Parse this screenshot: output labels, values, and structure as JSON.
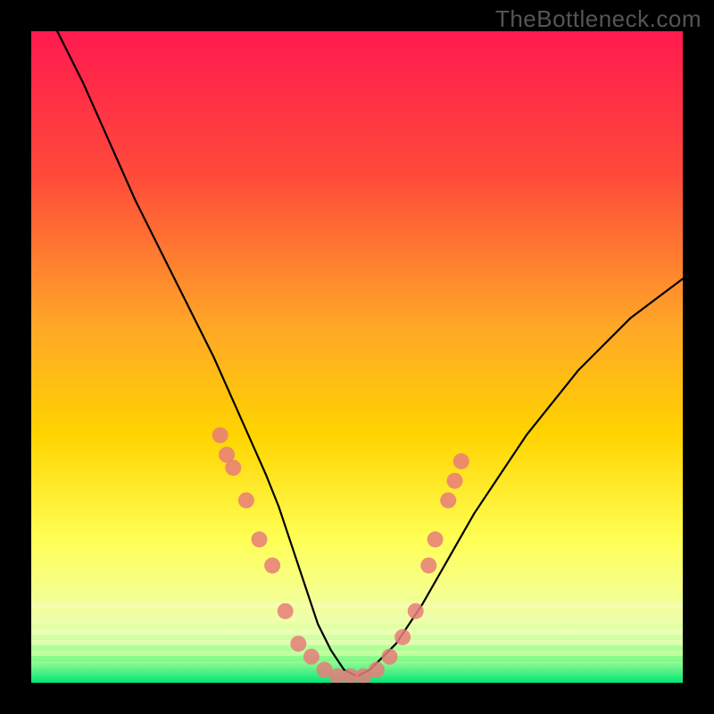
{
  "watermark": "TheBottleneck.com",
  "chart_data": {
    "type": "line",
    "title": "",
    "xlabel": "",
    "ylabel": "",
    "xlim": [
      0,
      100
    ],
    "ylim": [
      0,
      100
    ],
    "background_gradient": {
      "top": "#ff1a4f",
      "mid_upper": "#ff7a2a",
      "mid": "#ffd400",
      "mid_lower": "#ffff66",
      "band": "#f6ffb0",
      "bottom": "#00e676"
    },
    "curve": {
      "name": "bottleneck-curve",
      "x": [
        4,
        8,
        12,
        16,
        20,
        24,
        28,
        32,
        36,
        38,
        40,
        42,
        44,
        46,
        48,
        50,
        52,
        56,
        60,
        64,
        68,
        72,
        76,
        80,
        84,
        88,
        92,
        96,
        100
      ],
      "y": [
        100,
        92,
        83,
        74,
        66,
        58,
        50,
        41,
        32,
        27,
        21,
        15,
        9,
        5,
        2,
        1,
        2,
        6,
        12,
        19,
        26,
        32,
        38,
        43,
        48,
        52,
        56,
        59,
        62
      ]
    },
    "markers": {
      "name": "sample-points",
      "color": "#e77d7a",
      "points": [
        {
          "x": 29,
          "y": 38
        },
        {
          "x": 30,
          "y": 35
        },
        {
          "x": 31,
          "y": 33
        },
        {
          "x": 33,
          "y": 28
        },
        {
          "x": 35,
          "y": 22
        },
        {
          "x": 37,
          "y": 18
        },
        {
          "x": 39,
          "y": 11
        },
        {
          "x": 41,
          "y": 6
        },
        {
          "x": 43,
          "y": 4
        },
        {
          "x": 45,
          "y": 2
        },
        {
          "x": 47,
          "y": 1
        },
        {
          "x": 49,
          "y": 1
        },
        {
          "x": 51,
          "y": 1
        },
        {
          "x": 53,
          "y": 2
        },
        {
          "x": 55,
          "y": 4
        },
        {
          "x": 57,
          "y": 7
        },
        {
          "x": 59,
          "y": 11
        },
        {
          "x": 61,
          "y": 18
        },
        {
          "x": 62,
          "y": 22
        },
        {
          "x": 64,
          "y": 28
        },
        {
          "x": 65,
          "y": 31
        },
        {
          "x": 66,
          "y": 34
        }
      ]
    }
  }
}
